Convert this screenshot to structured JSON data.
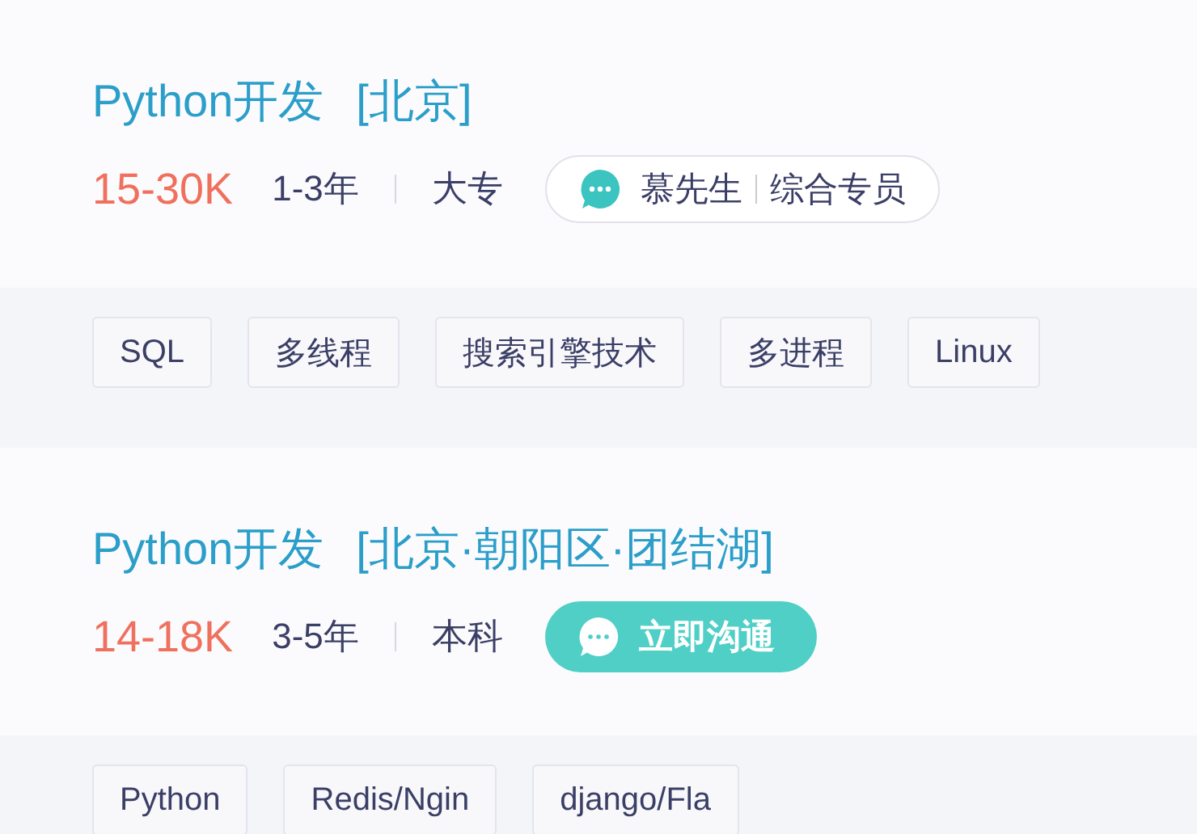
{
  "jobs": [
    {
      "title": "Python开发",
      "location": "[北京]",
      "salary": "15-30K",
      "experience": "1-3年",
      "education": "大专",
      "contact": {
        "kind": "recruiter",
        "name": "慕先生",
        "role": "综合专员"
      },
      "tags": [
        "SQL",
        "多线程",
        "搜索引擎技术",
        "多进程",
        "Linux"
      ]
    },
    {
      "title": "Python开发",
      "location": "[北京·朝阳区·团结湖]",
      "salary": "14-18K",
      "experience": "3-5年",
      "education": "本科",
      "contact": {
        "kind": "chat",
        "label": "立即沟通"
      },
      "tags": [
        "Python",
        "Redis/Ngin",
        "django/Fla"
      ]
    }
  ]
}
